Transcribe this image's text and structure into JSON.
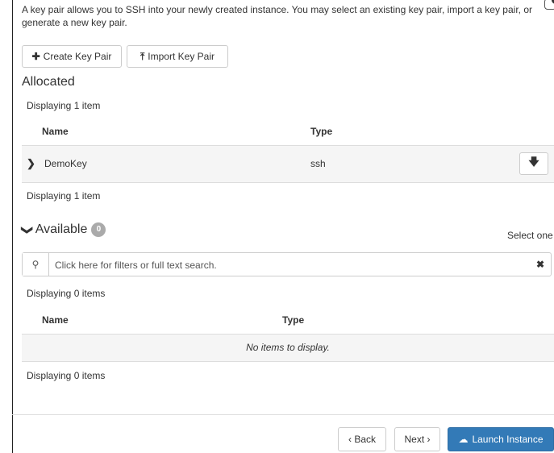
{
  "intro_text": "A key pair allows you to SSH into your newly created instance. You may select an existing key pair, import a key pair, or generate a new key pair.",
  "buttons": {
    "create_key_pair": "Create Key Pair",
    "import_key_pair": "Import Key Pair"
  },
  "allocated": {
    "title": "Allocated",
    "count_top": "Displaying 1 item",
    "count_bottom": "Displaying 1 item",
    "columns": {
      "name": "Name",
      "type": "Type"
    },
    "rows": [
      {
        "name": "DemoKey",
        "type": "ssh"
      }
    ]
  },
  "available": {
    "title": "Available",
    "badge": "0",
    "select_hint": "Select one",
    "search_placeholder": "Click here for filters or full text search.",
    "count_top": "Displaying 0 items",
    "count_bottom": "Displaying 0 items",
    "columns": {
      "name": "Name",
      "type": "Type"
    },
    "empty_text": "No items to display."
  },
  "footer": {
    "back": "‹ Back",
    "next": "Next ›",
    "launch": "Launch Instance"
  },
  "icons": {
    "plus": "plus-icon",
    "upload": "upload-icon",
    "search": "search-icon",
    "clear": "close-icon",
    "download": "arrow-down-icon",
    "cloud_upload": "cloud-upload-icon"
  },
  "colors": {
    "primary": "#337ab7",
    "row_bg": "#f5f5f5",
    "border": "#dddddd"
  }
}
